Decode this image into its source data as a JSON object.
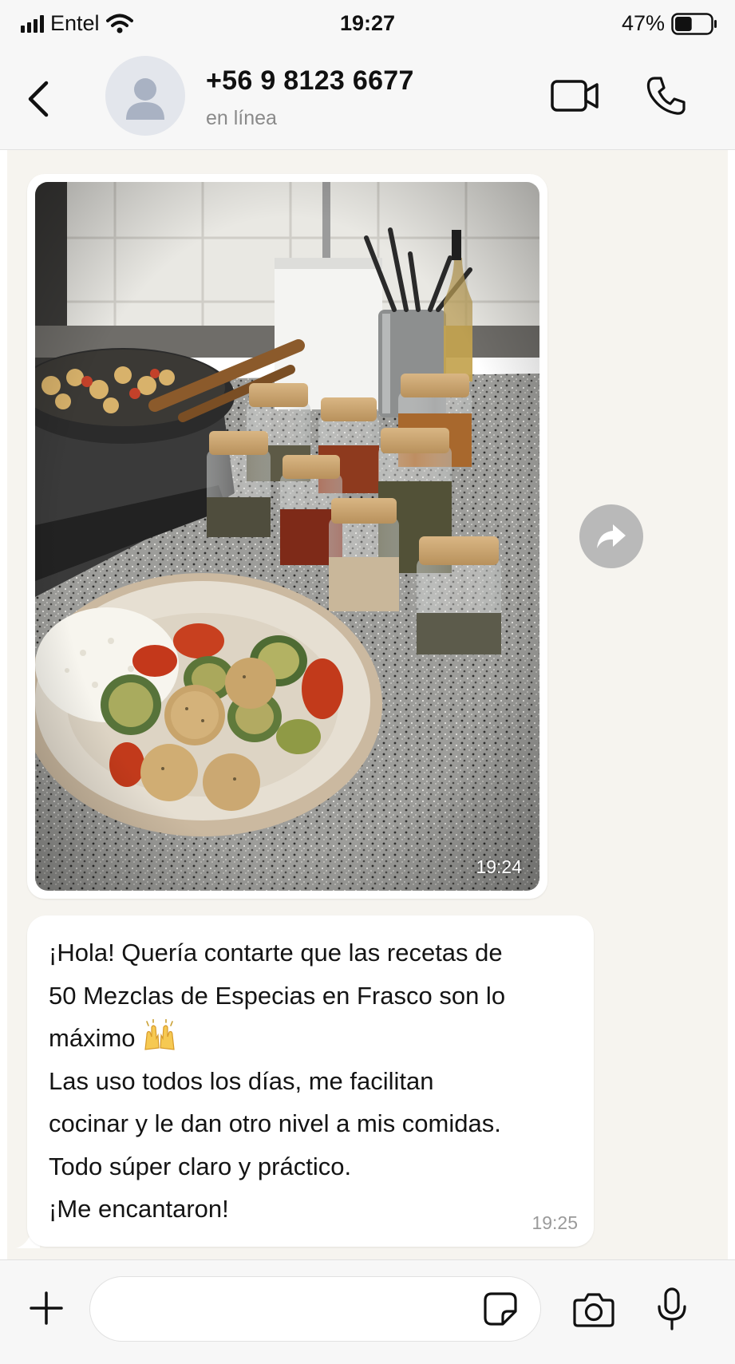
{
  "status_bar": {
    "carrier": "Entel",
    "time": "19:27",
    "battery": "47%",
    "battery_level": 0.47,
    "icons": [
      "signal-icon",
      "wifi-icon",
      "battery-icon"
    ]
  },
  "header": {
    "contact_name": "+56 9 8123 6677",
    "status": "en línea",
    "icons": [
      "back-icon",
      "avatar-icon",
      "video-call-icon",
      "phone-icon"
    ]
  },
  "messages": [
    {
      "type": "image",
      "time": "19:24"
    },
    {
      "type": "text",
      "lines": [
        "¡Hola! Quería contarte que las recetas de",
        "50 Mezclas de Especias en Frasco son lo",
        "máximo",
        "Las uso todos los días, me facilitan",
        "cocinar y le dan otro nivel a mis comidas.",
        "Todo súper claro y práctico.",
        "¡Me encantaron!"
      ],
      "emoji": "raising-hands-emoji",
      "time": "19:25"
    }
  ],
  "forward_icon": "forward-icon",
  "input_bar": {
    "placeholder": "",
    "icons": [
      "plus-icon",
      "sticker-icon",
      "camera-icon",
      "mic-icon"
    ]
  },
  "colors": {
    "chat_background": "#f6f4ef",
    "bubble": "#ffffff",
    "bar_background": "#f7f7f7",
    "muted_text": "#8a8a8a"
  }
}
